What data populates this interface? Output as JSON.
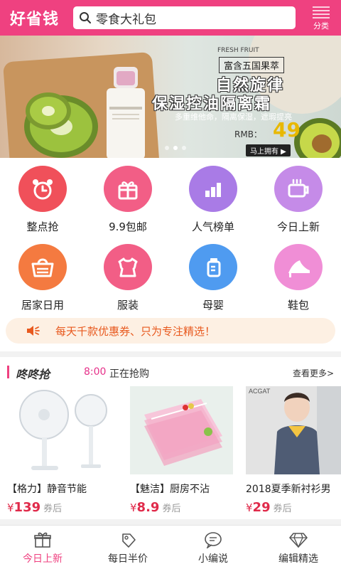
{
  "header": {
    "logo": "好省钱",
    "search_value": "零食大礼包",
    "category_label": "分类"
  },
  "banner": {
    "fresh_label": "FRESH FRUIT",
    "tag": "富含五国果萃",
    "headline_1": "自然旋律",
    "headline_2": "保湿控油隔离霜",
    "description": "多重维他命，隔离保湿，遮瑕提亮",
    "price_prefix": "RMB：",
    "price": "49",
    "buy_label": "马上拥有 ▶"
  },
  "grid": [
    {
      "label": "整点抢",
      "color": "#f0505a",
      "icon": "alarm-clock-icon"
    },
    {
      "label": "9.9包邮",
      "color": "#f25e86",
      "icon": "gift-box-icon"
    },
    {
      "label": "人气榜单",
      "color": "#a97be6",
      "icon": "bar-chart-icon"
    },
    {
      "label": "今日上新",
      "color": "#c58be8",
      "icon": "coffee-cup-icon"
    },
    {
      "label": "居家日用",
      "color": "#f47a40",
      "icon": "basket-icon"
    },
    {
      "label": "服装",
      "color": "#f25e86",
      "icon": "clothing-icon"
    },
    {
      "label": "母婴",
      "color": "#4f9bf0",
      "icon": "baby-bottle-icon"
    },
    {
      "label": "鞋包",
      "color": "#f08ed6",
      "icon": "high-heel-icon"
    }
  ],
  "notice": {
    "text": "每天千款优惠券、只为专注精选！"
  },
  "flash_sale": {
    "title": "咚咚抢",
    "time": "8:00",
    "status": "正在抢购",
    "more": "查看更多>"
  },
  "products": [
    {
      "name": "【格力】静音节能",
      "currency": "¥",
      "price": "139",
      "after": "券后"
    },
    {
      "name": "【魅洁】厨房不沾",
      "currency": "¥",
      "price": "8.9",
      "after": "券后"
    },
    {
      "name": "2018夏季新衬衫男",
      "currency": "¥",
      "price": "29",
      "after": "券后"
    }
  ],
  "product_brand_label": "ACGAT",
  "tabs": [
    {
      "label": "今日上新",
      "icon": "gift-icon"
    },
    {
      "label": "每日半价",
      "icon": "price-tag-icon"
    },
    {
      "label": "小编说",
      "icon": "chat-bubble-icon"
    },
    {
      "label": "编辑精选",
      "icon": "diamond-icon"
    }
  ],
  "colors": {
    "brand": "#ef4180",
    "price": "#e02a4a",
    "notice": "#e8591e"
  }
}
